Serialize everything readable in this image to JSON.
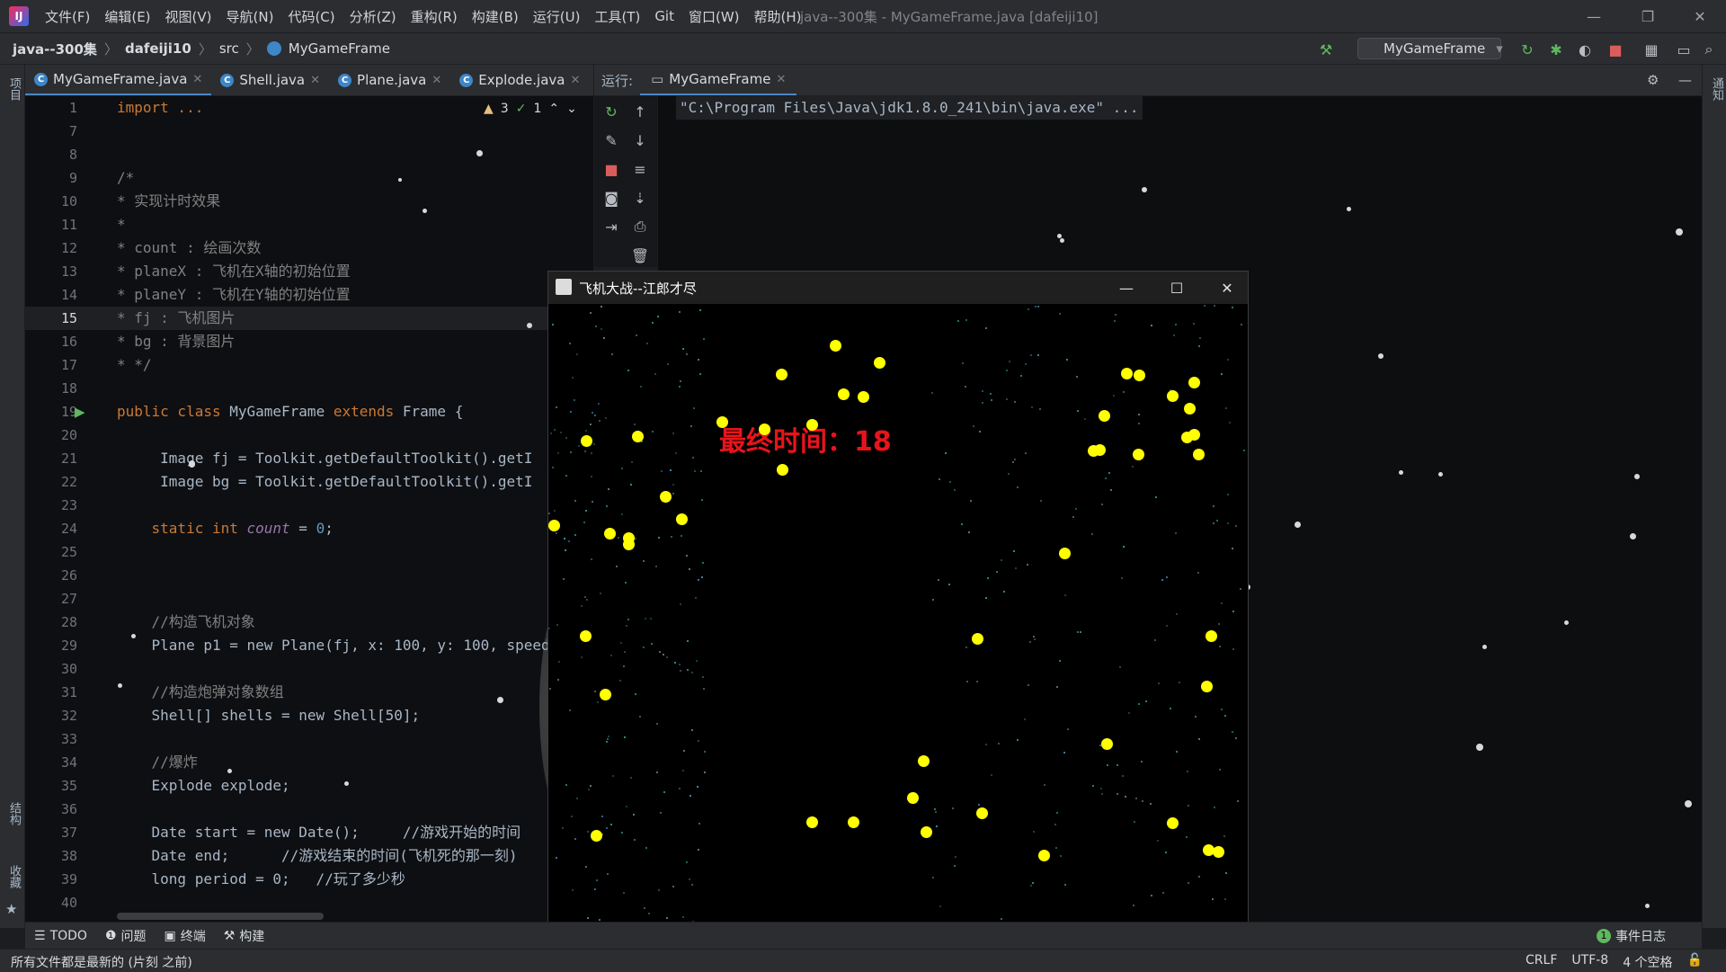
{
  "window": {
    "title": "java--300集 - MyGameFrame.java [dafeiji10]",
    "logo": "IJ"
  },
  "menu": [
    "文件(F)",
    "编辑(E)",
    "视图(V)",
    "导航(N)",
    "代码(C)",
    "分析(Z)",
    "重构(R)",
    "构建(B)",
    "运行(U)",
    "工具(T)",
    "Git",
    "窗口(W)",
    "帮助(H)"
  ],
  "breadcrumb": [
    "java--300集",
    "dafeiji10",
    "src",
    "MyGameFrame"
  ],
  "run_config": "MyGameFrame",
  "side_labels": {
    "left_top": "项目",
    "left_structure": "结构",
    "left_favorites": "收藏",
    "right_top": "通知"
  },
  "editor_tabs": [
    {
      "label": "MyGameFrame.java",
      "active": true
    },
    {
      "label": "Shell.java",
      "active": false
    },
    {
      "label": "Plane.java",
      "active": false
    },
    {
      "label": "Explode.java",
      "active": false
    }
  ],
  "inspections": {
    "warnings": "3",
    "ok": "1"
  },
  "code_lines": [
    {
      "n": "1",
      "t": "import ..."
    },
    {
      "n": "7",
      "t": ""
    },
    {
      "n": "8",
      "t": ""
    },
    {
      "n": "9",
      "t": "/*"
    },
    {
      "n": "10",
      "t": "* 实现计时效果"
    },
    {
      "n": "11",
      "t": "*"
    },
    {
      "n": "12",
      "t": "* count : 绘画次数"
    },
    {
      "n": "13",
      "t": "* planeX : 飞机在X轴的初始位置"
    },
    {
      "n": "14",
      "t": "* planeY : 飞机在Y轴的初始位置"
    },
    {
      "n": "15",
      "t": "* fj : 飞机图片"
    },
    {
      "n": "16",
      "t": "* bg : 背景图片"
    },
    {
      "n": "17",
      "t": "* */"
    },
    {
      "n": "18",
      "t": ""
    },
    {
      "n": "19",
      "t": "public class MyGameFrame extends Frame {"
    },
    {
      "n": "20",
      "t": ""
    },
    {
      "n": "21",
      "t": "     Image fj = Toolkit.getDefaultToolkit().getI"
    },
    {
      "n": "22",
      "t": "     Image bg = Toolkit.getDefaultToolkit().getI"
    },
    {
      "n": "23",
      "t": ""
    },
    {
      "n": "24",
      "t": "    static int count = 0;"
    },
    {
      "n": "25",
      "t": ""
    },
    {
      "n": "26",
      "t": ""
    },
    {
      "n": "27",
      "t": ""
    },
    {
      "n": "28",
      "t": "    //构造飞机对象"
    },
    {
      "n": "29",
      "t": "    Plane p1 = new Plane(fj, x: 100, y: 100, speed:"
    },
    {
      "n": "30",
      "t": ""
    },
    {
      "n": "31",
      "t": "    //构造炮弹对象数组"
    },
    {
      "n": "32",
      "t": "    Shell[] shells = new Shell[50];"
    },
    {
      "n": "33",
      "t": ""
    },
    {
      "n": "34",
      "t": "    //爆炸"
    },
    {
      "n": "35",
      "t": "    Explode explode;"
    },
    {
      "n": "36",
      "t": ""
    },
    {
      "n": "37",
      "t": "    Date start = new Date();     //游戏开始的时间"
    },
    {
      "n": "38",
      "t": "    Date end;      //游戏结束的时间(飞机死的那一刻)"
    },
    {
      "n": "39",
      "t": "    long period = 0;   //玩了多少秒"
    },
    {
      "n": "40",
      "t": ""
    }
  ],
  "run_panel": {
    "label": "运行:",
    "tab": "MyGameFrame",
    "console_line": "\"C:\\Program Files\\Java\\jdk1.8.0_241\\bin\\java.exe\" ..."
  },
  "game_window": {
    "title": "飞机大战--江郎才尽",
    "final_time_text": "最终时间：18"
  },
  "bottom_tools": [
    "TODO",
    "问题",
    "终端",
    "构建"
  ],
  "event_log": {
    "count": "1",
    "label": "事件日志"
  },
  "status": {
    "message": "所有文件都是最新的 (片刻 之前)",
    "line_sep": "CRLF",
    "encoding": "UTF-8",
    "indent": "4 个空格"
  },
  "colors": {
    "keyword": "#cc7832",
    "comment": "#808080",
    "number": "#6897bb",
    "field": "#9876aa",
    "final_time": "#e8141b",
    "shell": "#ffff00"
  }
}
